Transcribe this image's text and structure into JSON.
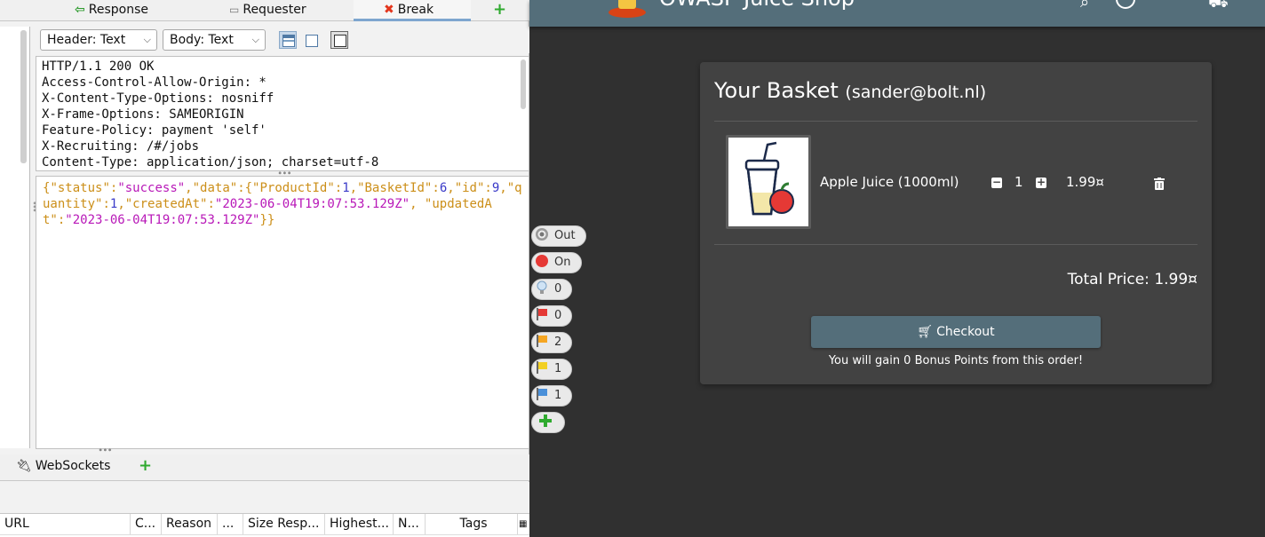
{
  "zap": {
    "tabs": {
      "response": "Response",
      "requester": "Requester",
      "break": "Break",
      "add": "+"
    },
    "toolbar": {
      "header_view": "Header: Text",
      "body_view": "Body: Text"
    },
    "response_headers": "HTTP/1.1 200 OK\nAccess-Control-Allow-Origin: *\nX-Content-Type-Options: nosniff\nX-Frame-Options: SAMEORIGIN\nFeature-Policy: payment 'self'\nX-Recruiting: /#/jobs\nContent-Type: application/json; charset=utf-8",
    "response_body": {
      "status_key": "\"status\"",
      "status_val": "\"success\"",
      "data_key": "\"data\"",
      "product_key": "\"ProductId\"",
      "product_val": "1",
      "basket_key": "\"BasketId\"",
      "basket_val": "6",
      "id_key": "\"id\"",
      "id_val": "9",
      "quantity_key": "\"quantity\"",
      "quantity_val": "1",
      "created_key": "\"createdAt\"",
      "created_val": "\"2023-06-04T19:07:53.129Z\"",
      "updated_key": "\"updatedAt\"",
      "updated_val": "\"2023-06-04T19:07:53.129Z\""
    },
    "websockets_tab": "WebSockets",
    "history_columns": [
      "URL",
      "C...",
      "Reason",
      "...",
      "Size Resp...",
      "Highest...",
      "N...",
      "Tags"
    ]
  },
  "hud": {
    "pills": [
      {
        "icon": "target-icon",
        "label": "Out"
      },
      {
        "icon": "break-on-icon",
        "label": "On"
      },
      {
        "icon": "lightbulb-icon",
        "label": "0"
      },
      {
        "icon": "red-flag-icon",
        "label": "0"
      },
      {
        "icon": "orange-flag-icon",
        "label": "2"
      },
      {
        "icon": "yellow-flag-icon",
        "label": "1"
      },
      {
        "icon": "blue-flag-icon",
        "label": "1"
      }
    ],
    "colors": {
      "red": "#e53935",
      "orange": "#f5a623",
      "yellow": "#f2d024",
      "blue": "#4a90d9",
      "green": "#2faa2f"
    }
  },
  "shop": {
    "title": "OWASP Juice Shop",
    "basket_title": "Your Basket",
    "basket_user": "(sander@bolt.nl)",
    "item": {
      "name": "Apple Juice (1000ml)",
      "quantity": "1",
      "price": "1.99¤"
    },
    "total": "Total Price: 1.99¤",
    "checkout_label": "Checkout",
    "bonus_text": "You will gain 0 Bonus Points from this order!",
    "colors": {
      "background": "#303030",
      "card": "#424242",
      "toolbar": "#546e7a"
    }
  }
}
